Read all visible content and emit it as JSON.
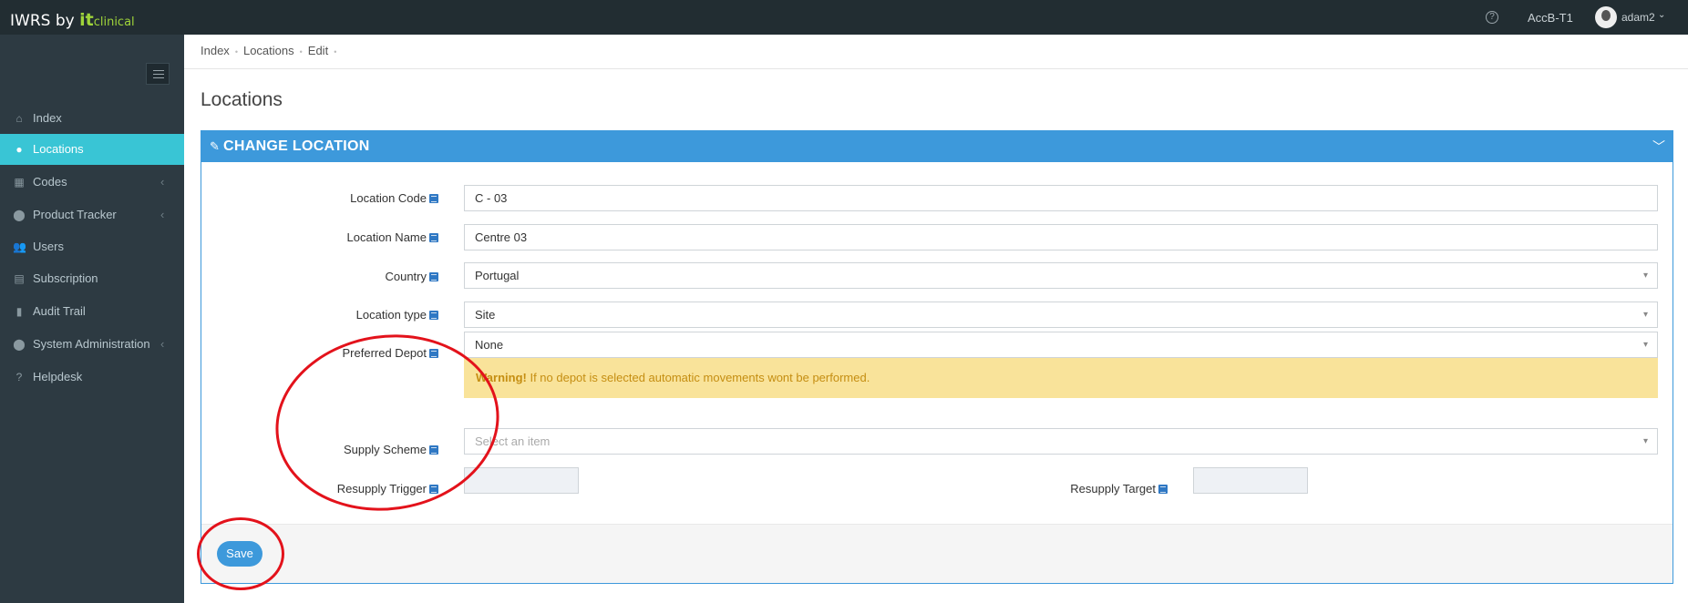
{
  "topbar": {
    "brand_prefix": "IWRS by ",
    "brand_it": "it",
    "brand_clinical": "clinical",
    "help": "?",
    "study": "AccB-T1",
    "user": "adam2",
    "caret": "⌄"
  },
  "sidebar": {
    "items": [
      {
        "label": "Index",
        "icon": "home-icon",
        "glyph": "⌂"
      },
      {
        "label": "Locations",
        "icon": "globe-icon",
        "glyph": "●"
      },
      {
        "label": "Codes",
        "icon": "table-icon",
        "glyph": "▦"
      },
      {
        "label": "Product Tracker",
        "icon": "map-marker-icon",
        "glyph": "⬤"
      },
      {
        "label": "Users",
        "icon": "users-icon",
        "glyph": "👥"
      },
      {
        "label": "Subscription",
        "icon": "archive-icon",
        "glyph": "▤"
      },
      {
        "label": "Audit Trail",
        "icon": "book-icon",
        "glyph": "▮"
      },
      {
        "label": "System Administration",
        "icon": "map-marker-icon",
        "glyph": "⬤"
      },
      {
        "label": "Helpdesk",
        "icon": "question-icon",
        "glyph": "?"
      }
    ],
    "chevron": "‹"
  },
  "breadcrumb": [
    "Index",
    "Locations",
    "Edit"
  ],
  "breadcrumb_sep": "•",
  "page_title": "Locations",
  "panel": {
    "title": "CHANGE LOCATION",
    "pencil": "✎",
    "collapse": "﹀"
  },
  "form": {
    "location_code_label": "Location Code",
    "location_code_value": "C - 03",
    "location_name_label": "Location Name",
    "location_name_value": "Centre 03",
    "country_label": "Country",
    "country_value": "Portugal",
    "location_type_label": "Location type",
    "location_type_value": "Site",
    "preferred_depot_label": "Preferred Depot",
    "preferred_depot_value": "None",
    "warning_strong": "Warning!",
    "warning_text": " If no depot is selected automatic movements wont be performed.",
    "supply_scheme_label": "Supply Scheme",
    "supply_scheme_placeholder": "Select an item",
    "resupply_trigger_label": "Resupply Trigger",
    "resupply_target_label": "Resupply Target"
  },
  "save_label": "Save",
  "colors": {
    "topbar": "#222d32",
    "sidebar": "#2d3a42",
    "active": "#39c5d5",
    "primary": "#3d99db",
    "warning_bg": "#f9e39a",
    "annotation": "#e3121b"
  }
}
